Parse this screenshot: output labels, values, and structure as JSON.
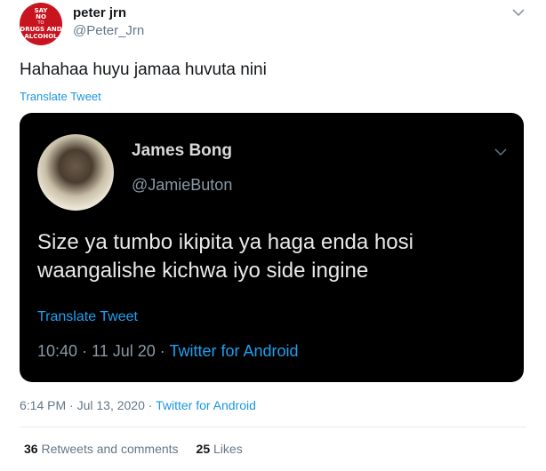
{
  "tweet": {
    "author_name": "peter jrn",
    "author_handle": "@Peter_Jrn",
    "avatar": {
      "line1": "SAY",
      "line2": "NO",
      "line3": "TO",
      "line4": "DRUGS AND",
      "line5": "ALCOHOL",
      "color": "#c8141e"
    },
    "text": "Hahahaa huyu jamaa huvuta nini",
    "translate_label": "Translate Tweet",
    "timestamp": "6:14 PM · Jul 13, 2020",
    "meta_separator": " · ",
    "source": "Twitter for Android",
    "retweets_count": "36",
    "retweets_label": "Retweets and comments",
    "likes_count": "25",
    "likes_label": "Likes"
  },
  "quoted": {
    "author_name": "James Bong",
    "author_handle": "@JamieButon",
    "text": "Size ya tumbo ikipita ya haga enda hosi waangalishe kichwa iyo side ingine",
    "translate_label": "Translate Tweet",
    "timestamp": "10:40 · 11 Jul 20",
    "meta_separator": " · ",
    "source": "Twitter for Android",
    "background": "#000000"
  },
  "colors": {
    "link": "#1b95e0",
    "secondary": "#657786"
  },
  "icons": {
    "menu": "chevron-down-icon",
    "quoted_menu": "chevron-down-icon"
  }
}
